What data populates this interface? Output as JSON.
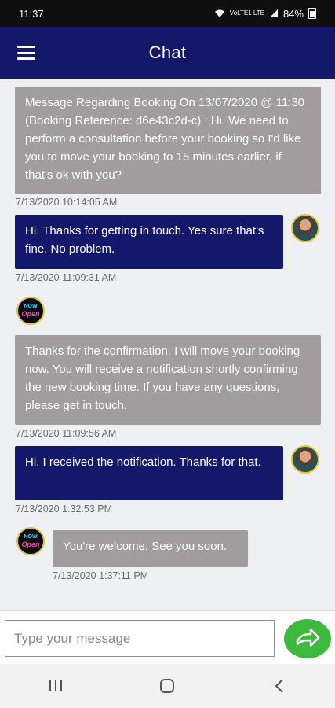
{
  "status_bar": {
    "time": "11:37",
    "network": "VoLTE1 LTE",
    "battery": "84%"
  },
  "header": {
    "title": "Chat"
  },
  "messages": [
    {
      "sender": "business",
      "text": "Message Regarding Booking On 13/07/2020 @ 11:30 (Booking Reference: d6e43c2d-c) : Hi. We need to perform a consultation before your booking so I'd like you to move your booking to 15 minutes earlier, if that's ok with you?",
      "timestamp": "7/13/2020 10:14:05 AM"
    },
    {
      "sender": "user",
      "text": "Hi. Thanks for getting in touch. Yes sure that's fine. No problem.",
      "timestamp": "7/13/2020 11:09:31 AM"
    },
    {
      "sender": "business",
      "text": "Thanks for the confirmation. I will move your booking now. You will receive a notification shortly confirming the new booking time. If you have any questions, please get in touch.",
      "timestamp": "7/13/2020 11:09:56 AM"
    },
    {
      "sender": "user",
      "text": "Hi. I received the notification. Thanks for that.",
      "timestamp": "7/13/2020 1:32:53 PM"
    },
    {
      "sender": "business",
      "text": "You're welcome. See you soon.",
      "timestamp": "7/13/2020 1:37:11 PM"
    }
  ],
  "business_avatar": {
    "line1": "NOW",
    "line2": "Open"
  },
  "composer": {
    "placeholder": "Type your message"
  },
  "icons": {
    "menu": "hamburger-icon",
    "send": "arrow-right-icon",
    "nav_recents": "recents-icon",
    "nav_home": "home-icon",
    "nav_back": "back-icon"
  },
  "colors": {
    "header_bg": "#14186b",
    "user_bubble": "#14186b",
    "business_bubble": "#a19d9e",
    "send_button": "#3fb83e",
    "avatar_ring": "#f2c02f"
  }
}
